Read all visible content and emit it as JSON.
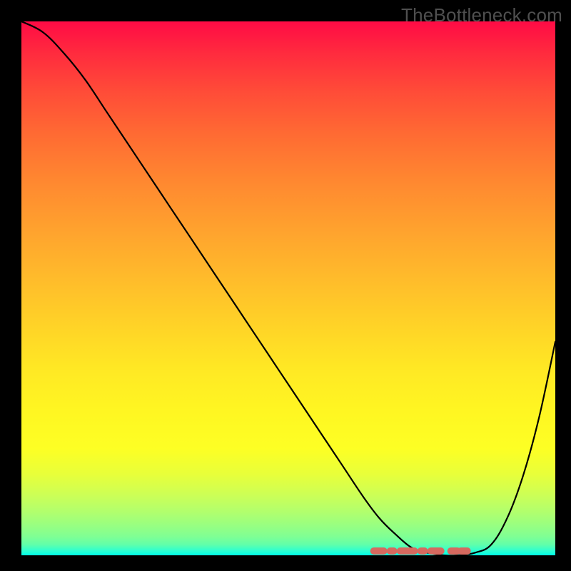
{
  "watermark": "TheBottleneck.com",
  "colors": {
    "frame_bg": "#000000",
    "curve": "#000000",
    "band": "#d6695f",
    "gradient_top": "#ff0b45",
    "gradient_bottom": "#00ffe6"
  },
  "chart_data": {
    "type": "line",
    "title": "",
    "xlabel": "",
    "ylabel": "",
    "xlim": [
      0,
      100
    ],
    "ylim": [
      0,
      100
    ],
    "grid": false,
    "legend": false,
    "annotation_text": "TheBottleneck.com",
    "series": [
      {
        "name": "bottleneck-curve",
        "x": [
          0,
          4,
          8,
          12,
          16,
          20,
          24,
          28,
          32,
          36,
          40,
          44,
          48,
          52,
          56,
          60,
          64,
          67,
          70,
          73,
          76,
          79,
          82,
          85,
          88,
          91,
          94,
          97,
          100
        ],
        "y": [
          100,
          98,
          94,
          89,
          83,
          77,
          71,
          65,
          59,
          53,
          47,
          41,
          35,
          29,
          23,
          17,
          11,
          7,
          4,
          1.5,
          0.5,
          0,
          0,
          0.5,
          2,
          7,
          15,
          26,
          40
        ]
      }
    ],
    "optimal_band": {
      "name": "optimal-range",
      "x_start": 66,
      "x_end": 86,
      "y": 0.8,
      "color": "#d6695f"
    }
  }
}
